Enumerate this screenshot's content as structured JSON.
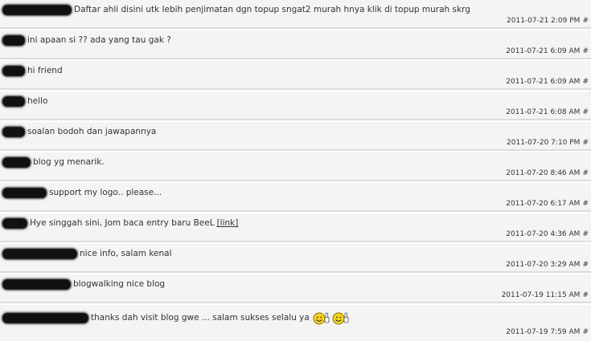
{
  "comments": [
    {
      "text": "Daftar ahli disini utk lebih penjimatan dgn topup sngat2 murah hnya klik di topup murah skrg",
      "time": "2011-07-21 2:09 PM",
      "perma": "#"
    },
    {
      "text": "ini apaan si ?? ada yang tau gak ?",
      "time": "2011-07-21 6:09 AM",
      "perma": "#"
    },
    {
      "text": "hi friend",
      "time": "2011-07-21 6:09 AM",
      "perma": "#"
    },
    {
      "text": "hello",
      "time": "2011-07-21 6:08 AM",
      "perma": "#"
    },
    {
      "text": "soalan bodoh dan jawapannya",
      "time": "2011-07-20 7:10 PM",
      "perma": "#"
    },
    {
      "text": "blog yg menarik.",
      "time": "2011-07-20 8:46 AM",
      "perma": "#"
    },
    {
      "text": "support my logo.. please...",
      "time": "2011-07-20 6:17 AM",
      "perma": "#"
    },
    {
      "text": "Hye singgah sini, Jom baca entry baru BeeL",
      "link": "[link]",
      "time": "2011-07-20 4:36 AM",
      "perma": "#"
    },
    {
      "text": "nice info, salam kenal",
      "time": "2011-07-20 3:29 AM",
      "perma": "#"
    },
    {
      "text": "blogwalking nice blog",
      "time": "2011-07-19 11:15 AM",
      "perma": "#"
    },
    {
      "text": "thanks dah visit blog gwe ... salam sukses selalu ya",
      "time": "2011-07-19 7:59 AM",
      "perma": "#"
    }
  ],
  "colors": {
    "row_bg": "#f4f4f4",
    "separator": "#dcdcdc",
    "text": "#333333"
  },
  "icons": [
    "smiley-thumbs-up-icon",
    "smiley-thumbs-up-icon"
  ]
}
